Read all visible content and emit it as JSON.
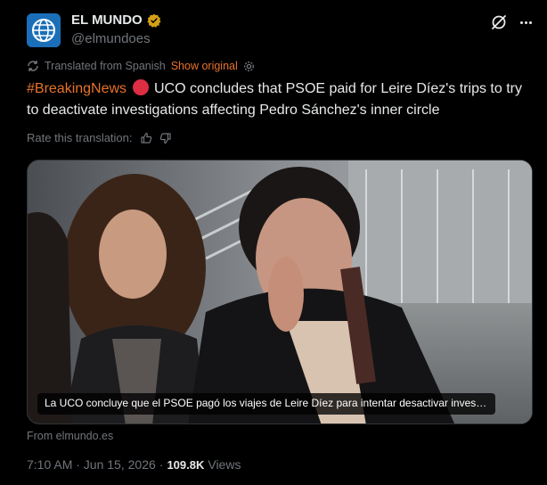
{
  "account": {
    "display_name": "EL MUNDO",
    "handle": "@elmundoes",
    "verified": true,
    "verified_color": "#d4a017"
  },
  "translation": {
    "label": "Translated from Spanish",
    "show_original": "Show original"
  },
  "tweet": {
    "hashtag": "#BreakingNews",
    "body": "UCO concludes that PSOE paid for Leire Díez's trips to try to deactivate investigations affecting Pedro Sánchez's inner circle"
  },
  "rate": {
    "label": "Rate this translation:"
  },
  "media": {
    "caption": "La UCO concluye que el PSOE pagó los viajes de Leire Díez para intentar desactivar investigaci..."
  },
  "source": "From elmundo.es",
  "meta": {
    "timestamp": "7:10 AM · Jun 15, 2026",
    "dot": "·",
    "views_count": "109.8K",
    "views_label": "Views"
  },
  "colors": {
    "accent": "#e8722a",
    "background": "#000000",
    "text": "#e7e9ea",
    "muted": "#71767b"
  }
}
